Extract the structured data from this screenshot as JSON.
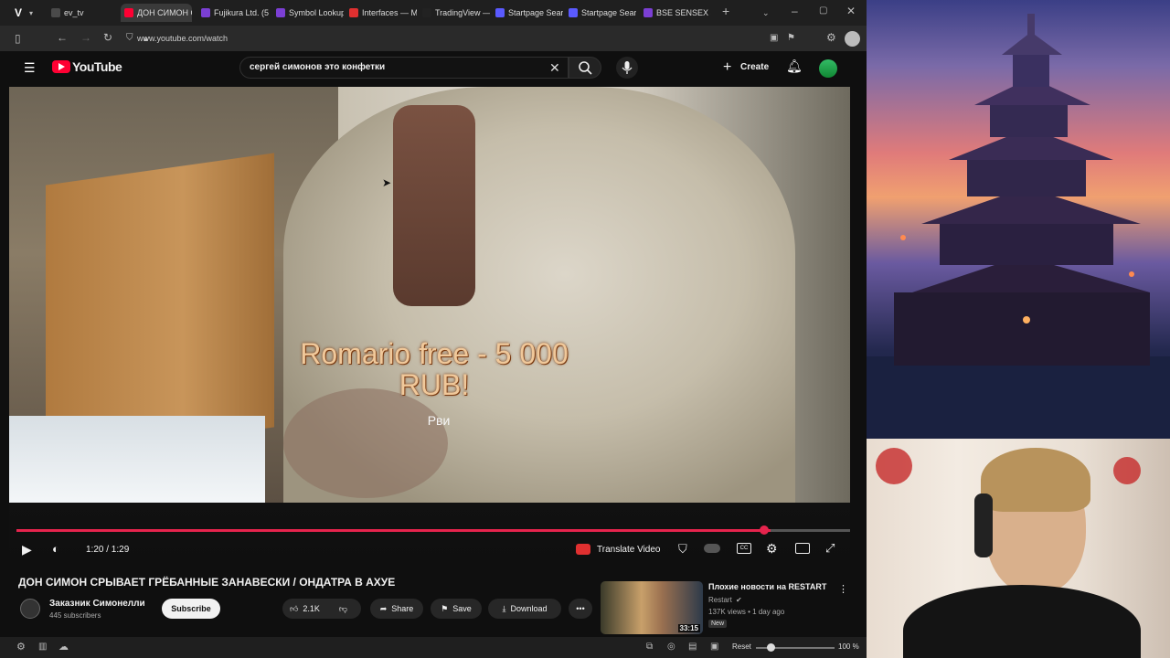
{
  "browser": {
    "tabs": [
      {
        "label": "ev_tv",
        "color": "#4a4a4a"
      },
      {
        "label": "ДОН СИМОН С",
        "color": "#ff0033"
      },
      {
        "label": "Fujikura Ltd. (5",
        "color": "#7b3fd4"
      },
      {
        "label": "Symbol Lookup",
        "color": "#7b3fd4"
      },
      {
        "label": "Interfaces — M",
        "color": "#e03030"
      },
      {
        "label": "TradingView —",
        "color": "#222222"
      },
      {
        "label": "Startpage Searc",
        "color": "#5a5aff"
      },
      {
        "label": "Startpage Searc",
        "color": "#5a5aff"
      },
      {
        "label": "BSE SENSEX Sto",
        "color": "#7b3fd4"
      }
    ],
    "url": "www.youtube.com/watch"
  },
  "youtube": {
    "logo_text": "YouTube",
    "search_value": "сергей симонов это конфетки",
    "create_label": "Create"
  },
  "video": {
    "caption_line1": "Romario free - 5 000",
    "caption_line2": "RUB!",
    "caption_sub": "Рви",
    "time": "1:20 / 1:29",
    "progress": 0.905,
    "translate_label": "Translate Video"
  },
  "meta": {
    "title": "ДОН СИМОН СРЫВАЕТ ГРЁБАННЫЕ ЗАНАВЕСКИ / ОНДАТРА В АХУЕ",
    "channel": "Заказник Симонелли",
    "subscribers": "445 subscribers",
    "subscribe_label": "Subscribe",
    "likes": "2.1K",
    "share_label": "Share",
    "save_label": "Save",
    "download_label": "Download"
  },
  "recommended": {
    "title": "Плохие новости на RESTART",
    "channel": "Restart",
    "stats": "137K views • 1 day ago",
    "badge": "New",
    "duration": "33:15"
  },
  "statusbar": {
    "reset_label": "Reset",
    "zoom": "100 %"
  }
}
